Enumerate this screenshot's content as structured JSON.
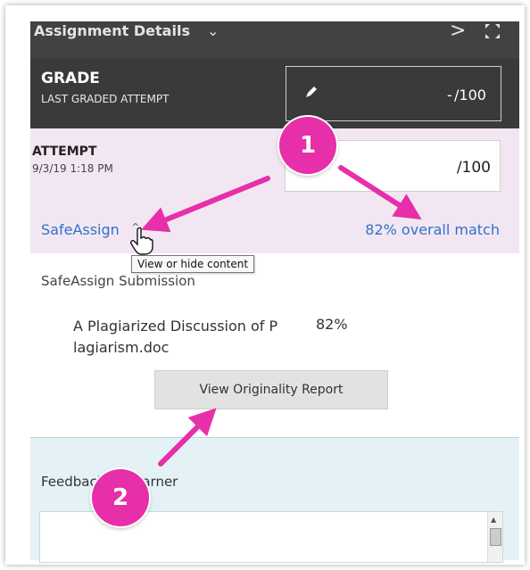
{
  "titlebar": {
    "title": "Assignment Details",
    "chevron": "chevron-down-icon",
    "next": "chevron-right-icon",
    "expand": "expand-icon"
  },
  "grade": {
    "heading": "GRADE",
    "subheading": "LAST GRADED ATTEMPT",
    "value": "-",
    "out_of": "/100"
  },
  "attempt": {
    "heading": "ATTEMPT",
    "date": "9/3/19 1:18 PM",
    "out_of": "/100",
    "safeassign_link": "SafeAssign",
    "match": "82% overall match"
  },
  "tooltip": "View or hide content",
  "submission": {
    "label": "SafeAssign Submission",
    "file_name": "A Plagiarized Discussion of P lagiarism.doc",
    "percent": "82%",
    "button": "View Originality Report"
  },
  "feedback": {
    "label": "Feedback to Learner"
  },
  "annotations": [
    {
      "label": "1"
    },
    {
      "label": "2"
    }
  ],
  "colors": {
    "accent": "#e62fa8",
    "link": "#2f72c9",
    "attempt_bg": "#f3e6f3",
    "feedback_bg": "#e4f2f6"
  }
}
